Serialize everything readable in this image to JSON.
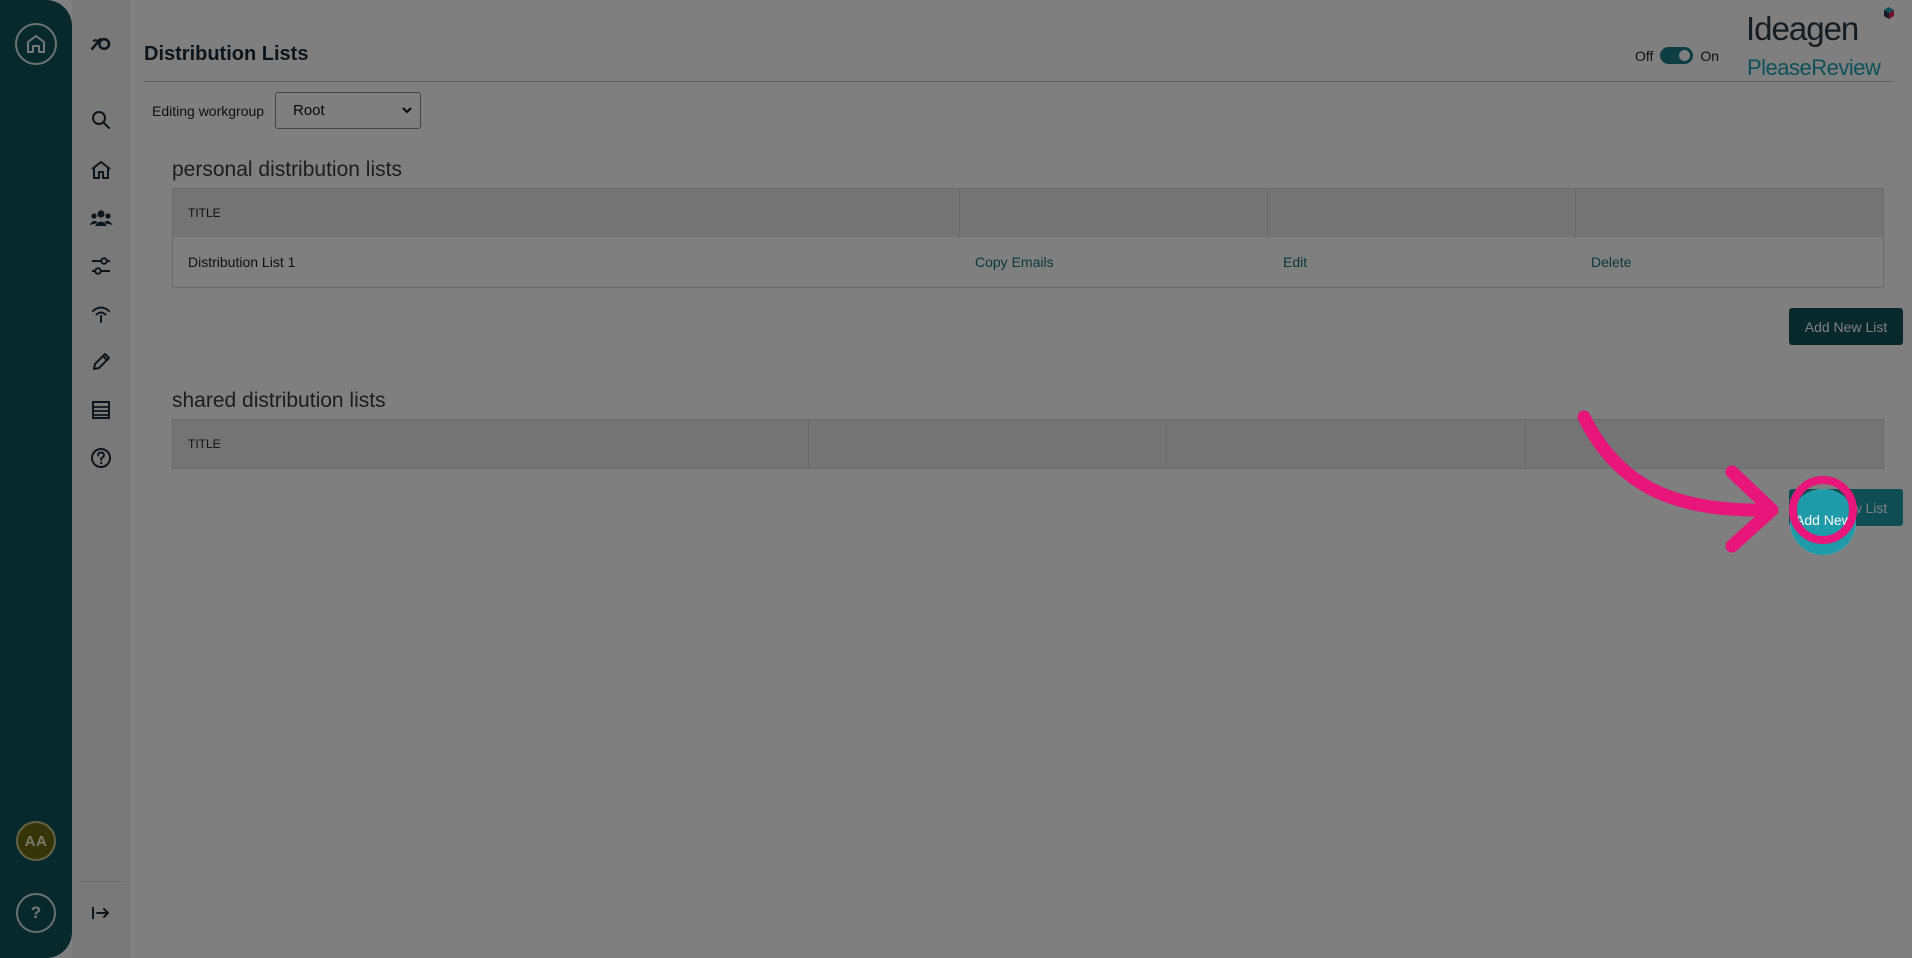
{
  "page": {
    "title": "Distribution Lists"
  },
  "toggle": {
    "off_label": "Off",
    "on_label": "On",
    "state": "on",
    "color": "#197d86"
  },
  "logo": {
    "brand": "Ideagen",
    "product": "PleaseReview"
  },
  "workgroup": {
    "label": "Editing workgroup",
    "selected": "Root"
  },
  "rail": {
    "avatar_initials": "AA",
    "help_label": "?",
    "icons": [
      "home-icon",
      "help-icon"
    ]
  },
  "toolbar": {
    "icons": [
      "brand-logo-icon",
      "search-icon",
      "home-icon",
      "people-icon",
      "sliders-icon",
      "signal-icon",
      "pencil-icon",
      "list-icon",
      "help-icon",
      "collapse-icon"
    ]
  },
  "personal": {
    "heading": "personal distribution lists",
    "columns": [
      "TITLE",
      "",
      "",
      ""
    ],
    "rows": [
      {
        "title": "Distribution List 1",
        "copy": "Copy Emails",
        "edit": "Edit",
        "delete": "Delete"
      }
    ],
    "add_button": "Add New List"
  },
  "shared": {
    "heading": "shared distribution lists",
    "columns": [
      "TITLE",
      "",
      "",
      ""
    ],
    "rows": [],
    "add_button": "Add New List"
  },
  "colors": {
    "rail": "#0f5257",
    "accent": "#19a3b4",
    "link": "#19707a",
    "annotation": "#e8157a"
  }
}
